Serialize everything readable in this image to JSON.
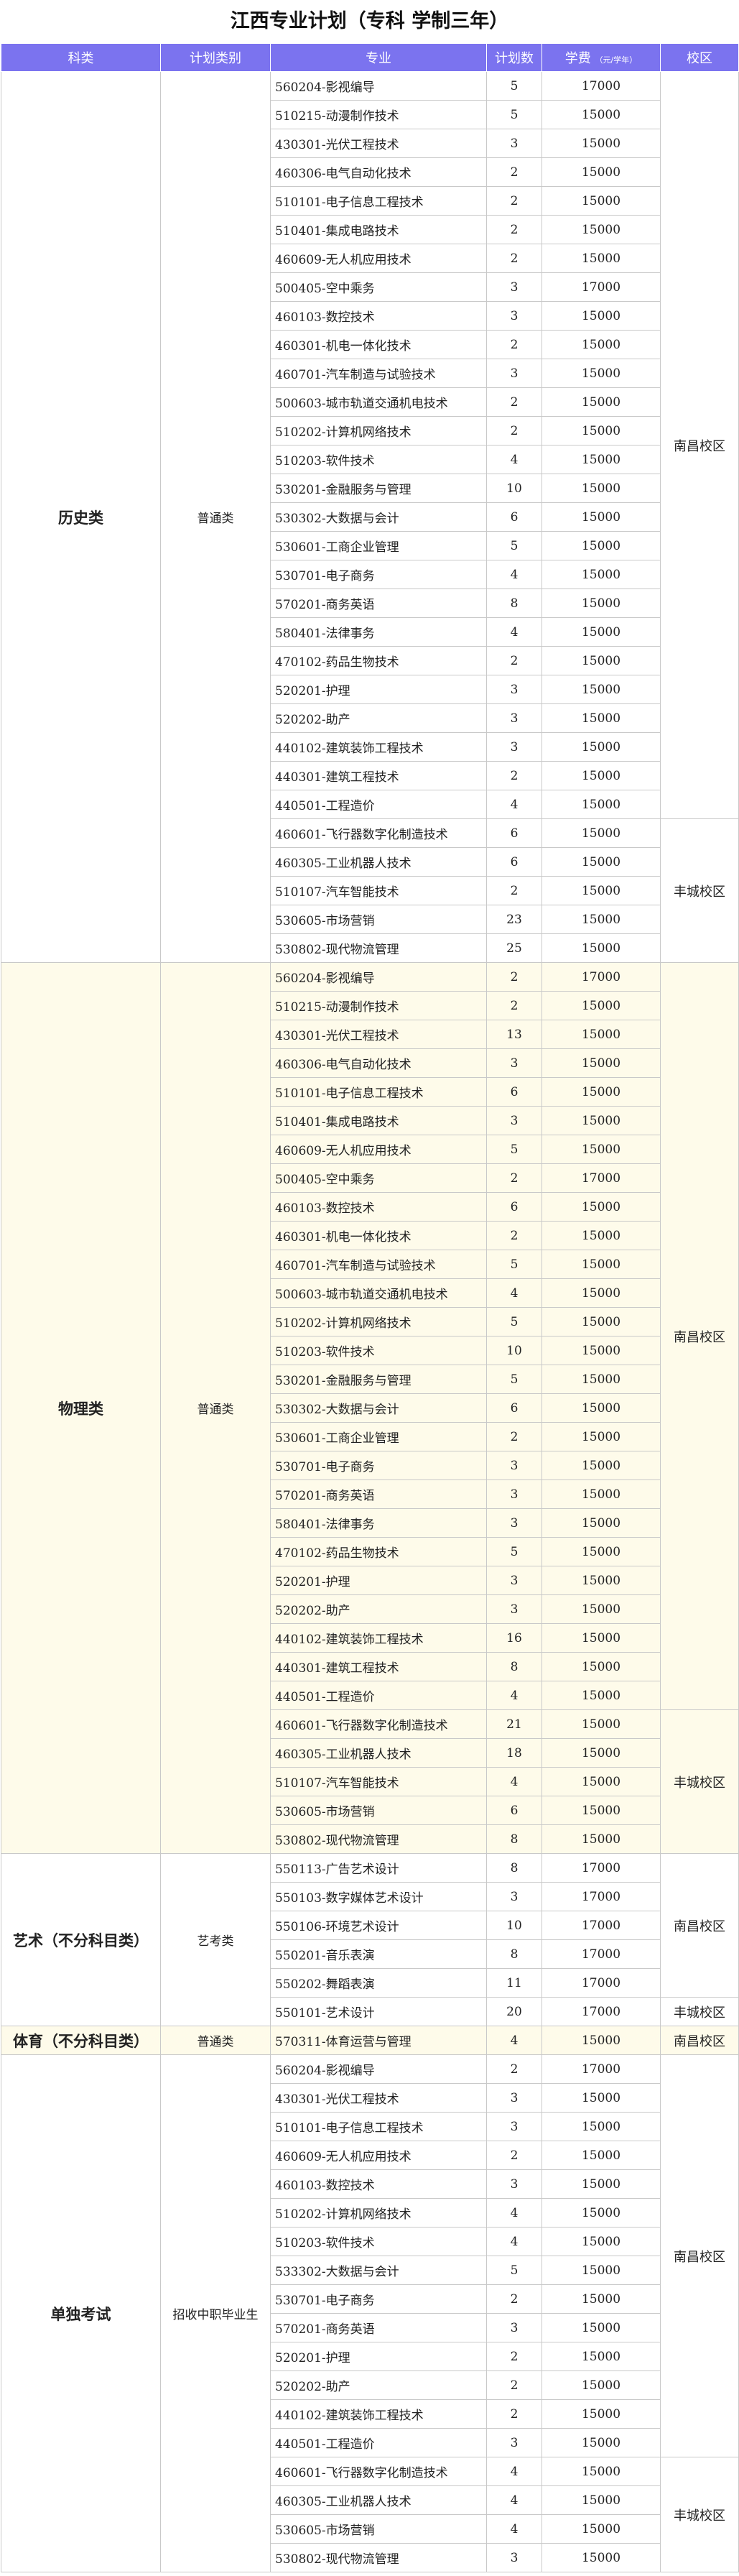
{
  "title": "江西专业计划（专科 学制三年）",
  "colors": {
    "header_bg": "#7b73ef",
    "header_text": "#ffffff",
    "shade_bg": "#fefbea",
    "border": "#c9c9c9"
  },
  "headers": {
    "category": "科类",
    "plan_type": "计划类别",
    "major": "专业",
    "count": "计划数",
    "fee": "学费",
    "fee_unit": "（元/学年）",
    "campus": "校区"
  },
  "sections": [
    {
      "category": "历史类",
      "plan_type": "普通类",
      "shade": false,
      "campuses": [
        {
          "name": "南昌校区",
          "rows": [
            {
              "major": "560204-影视编导",
              "count": "5",
              "fee": "17000"
            },
            {
              "major": "510215-动漫制作技术",
              "count": "5",
              "fee": "15000"
            },
            {
              "major": "430301-光伏工程技术",
              "count": "3",
              "fee": "15000"
            },
            {
              "major": "460306-电气自动化技术",
              "count": "2",
              "fee": "15000"
            },
            {
              "major": "510101-电子信息工程技术",
              "count": "2",
              "fee": "15000"
            },
            {
              "major": "510401-集成电路技术",
              "count": "2",
              "fee": "15000"
            },
            {
              "major": "460609-无人机应用技术",
              "count": "2",
              "fee": "15000"
            },
            {
              "major": "500405-空中乘务",
              "count": "3",
              "fee": "17000"
            },
            {
              "major": "460103-数控技术",
              "count": "3",
              "fee": "15000"
            },
            {
              "major": "460301-机电一体化技术",
              "count": "2",
              "fee": "15000"
            },
            {
              "major": "460701-汽车制造与试验技术",
              "count": "3",
              "fee": "15000"
            },
            {
              "major": "500603-城市轨道交通机电技术",
              "count": "2",
              "fee": "15000"
            },
            {
              "major": "510202-计算机网络技术",
              "count": "2",
              "fee": "15000"
            },
            {
              "major": "510203-软件技术",
              "count": "4",
              "fee": "15000"
            },
            {
              "major": "530201-金融服务与管理",
              "count": "10",
              "fee": "15000"
            },
            {
              "major": "530302-大数据与会计",
              "count": "6",
              "fee": "15000"
            },
            {
              "major": "530601-工商企业管理",
              "count": "5",
              "fee": "15000"
            },
            {
              "major": "530701-电子商务",
              "count": "4",
              "fee": "15000"
            },
            {
              "major": "570201-商务英语",
              "count": "8",
              "fee": "15000"
            },
            {
              "major": "580401-法律事务",
              "count": "4",
              "fee": "15000"
            },
            {
              "major": "470102-药品生物技术",
              "count": "2",
              "fee": "15000"
            },
            {
              "major": "520201-护理",
              "count": "3",
              "fee": "15000"
            },
            {
              "major": "520202-助产",
              "count": "3",
              "fee": "15000"
            },
            {
              "major": "440102-建筑装饰工程技术",
              "count": "3",
              "fee": "15000"
            },
            {
              "major": "440301-建筑工程技术",
              "count": "2",
              "fee": "15000"
            },
            {
              "major": "440501-工程造价",
              "count": "4",
              "fee": "15000"
            }
          ]
        },
        {
          "name": "丰城校区",
          "rows": [
            {
              "major": "460601-飞行器数字化制造技术",
              "count": "6",
              "fee": "15000"
            },
            {
              "major": "460305-工业机器人技术",
              "count": "6",
              "fee": "15000"
            },
            {
              "major": "510107-汽车智能技术",
              "count": "2",
              "fee": "15000"
            },
            {
              "major": "530605-市场营销",
              "count": "23",
              "fee": "15000"
            },
            {
              "major": "530802-现代物流管理",
              "count": "25",
              "fee": "15000"
            }
          ]
        }
      ]
    },
    {
      "category": "物理类",
      "plan_type": "普通类",
      "shade": true,
      "campuses": [
        {
          "name": "南昌校区",
          "rows": [
            {
              "major": "560204-影视编导",
              "count": "2",
              "fee": "17000"
            },
            {
              "major": "510215-动漫制作技术",
              "count": "2",
              "fee": "15000"
            },
            {
              "major": "430301-光伏工程技术",
              "count": "13",
              "fee": "15000"
            },
            {
              "major": "460306-电气自动化技术",
              "count": "3",
              "fee": "15000"
            },
            {
              "major": "510101-电子信息工程技术",
              "count": "6",
              "fee": "15000"
            },
            {
              "major": "510401-集成电路技术",
              "count": "3",
              "fee": "15000"
            },
            {
              "major": "460609-无人机应用技术",
              "count": "5",
              "fee": "15000"
            },
            {
              "major": "500405-空中乘务",
              "count": "2",
              "fee": "17000"
            },
            {
              "major": "460103-数控技术",
              "count": "6",
              "fee": "15000"
            },
            {
              "major": "460301-机电一体化技术",
              "count": "2",
              "fee": "15000"
            },
            {
              "major": "460701-汽车制造与试验技术",
              "count": "5",
              "fee": "15000"
            },
            {
              "major": "500603-城市轨道交通机电技术",
              "count": "4",
              "fee": "15000"
            },
            {
              "major": "510202-计算机网络技术",
              "count": "5",
              "fee": "15000"
            },
            {
              "major": "510203-软件技术",
              "count": "10",
              "fee": "15000"
            },
            {
              "major": "530201-金融服务与管理",
              "count": "5",
              "fee": "15000"
            },
            {
              "major": "530302-大数据与会计",
              "count": "6",
              "fee": "15000"
            },
            {
              "major": "530601-工商企业管理",
              "count": "2",
              "fee": "15000"
            },
            {
              "major": "530701-电子商务",
              "count": "3",
              "fee": "15000"
            },
            {
              "major": "570201-商务英语",
              "count": "3",
              "fee": "15000"
            },
            {
              "major": "580401-法律事务",
              "count": "3",
              "fee": "15000"
            },
            {
              "major": "470102-药品生物技术",
              "count": "5",
              "fee": "15000"
            },
            {
              "major": "520201-护理",
              "count": "3",
              "fee": "15000"
            },
            {
              "major": "520202-助产",
              "count": "3",
              "fee": "15000"
            },
            {
              "major": "440102-建筑装饰工程技术",
              "count": "16",
              "fee": "15000"
            },
            {
              "major": "440301-建筑工程技术",
              "count": "8",
              "fee": "15000"
            },
            {
              "major": "440501-工程造价",
              "count": "4",
              "fee": "15000"
            }
          ]
        },
        {
          "name": "丰城校区",
          "rows": [
            {
              "major": "460601-飞行器数字化制造技术",
              "count": "21",
              "fee": "15000"
            },
            {
              "major": "460305-工业机器人技术",
              "count": "18",
              "fee": "15000"
            },
            {
              "major": "510107-汽车智能技术",
              "count": "4",
              "fee": "15000"
            },
            {
              "major": "530605-市场营销",
              "count": "6",
              "fee": "15000"
            },
            {
              "major": "530802-现代物流管理",
              "count": "8",
              "fee": "15000"
            }
          ]
        }
      ]
    },
    {
      "category": "艺术（不分科目类）",
      "plan_type": "艺考类",
      "shade": false,
      "campuses": [
        {
          "name": "南昌校区",
          "rows": [
            {
              "major": "550113-广告艺术设计",
              "count": "8",
              "fee": "17000"
            },
            {
              "major": "550103-数字媒体艺术设计",
              "count": "3",
              "fee": "17000"
            },
            {
              "major": "550106-环境艺术设计",
              "count": "10",
              "fee": "17000"
            },
            {
              "major": "550201-音乐表演",
              "count": "8",
              "fee": "17000"
            },
            {
              "major": "550202-舞蹈表演",
              "count": "11",
              "fee": "17000"
            }
          ]
        },
        {
          "name": "丰城校区",
          "rows": [
            {
              "major": "550101-艺术设计",
              "count": "20",
              "fee": "17000"
            }
          ]
        }
      ]
    },
    {
      "category": "体育（不分科目类）",
      "plan_type": "普通类",
      "shade": true,
      "campuses": [
        {
          "name": "南昌校区",
          "rows": [
            {
              "major": "570311-体育运营与管理",
              "count": "4",
              "fee": "15000"
            }
          ]
        }
      ]
    },
    {
      "category": "单独考试",
      "plan_type": "招收中职毕业生",
      "shade": false,
      "campuses": [
        {
          "name": "南昌校区",
          "rows": [
            {
              "major": "560204-影视编导",
              "count": "2",
              "fee": "17000"
            },
            {
              "major": "430301-光伏工程技术",
              "count": "3",
              "fee": "15000"
            },
            {
              "major": "510101-电子信息工程技术",
              "count": "3",
              "fee": "15000"
            },
            {
              "major": "460609-无人机应用技术",
              "count": "2",
              "fee": "15000"
            },
            {
              "major": "460103-数控技术",
              "count": "3",
              "fee": "15000"
            },
            {
              "major": "510202-计算机网络技术",
              "count": "4",
              "fee": "15000"
            },
            {
              "major": "510203-软件技术",
              "count": "4",
              "fee": "15000"
            },
            {
              "major": "533302-大数据与会计",
              "count": "5",
              "fee": "15000"
            },
            {
              "major": "530701-电子商务",
              "count": "2",
              "fee": "15000"
            },
            {
              "major": "570201-商务英语",
              "count": "3",
              "fee": "15000"
            },
            {
              "major": "520201-护理",
              "count": "2",
              "fee": "15000"
            },
            {
              "major": "520202-助产",
              "count": "2",
              "fee": "15000"
            },
            {
              "major": "440102-建筑装饰工程技术",
              "count": "2",
              "fee": "15000"
            },
            {
              "major": "440501-工程造价",
              "count": "3",
              "fee": "15000"
            }
          ]
        },
        {
          "name": "丰城校区",
          "rows": [
            {
              "major": "460601-飞行器数字化制造技术",
              "count": "4",
              "fee": "15000"
            },
            {
              "major": "460305-工业机器人技术",
              "count": "4",
              "fee": "15000"
            },
            {
              "major": "530605-市场营销",
              "count": "4",
              "fee": "15000"
            },
            {
              "major": "530802-现代物流管理",
              "count": "3",
              "fee": "15000"
            }
          ]
        }
      ]
    }
  ]
}
